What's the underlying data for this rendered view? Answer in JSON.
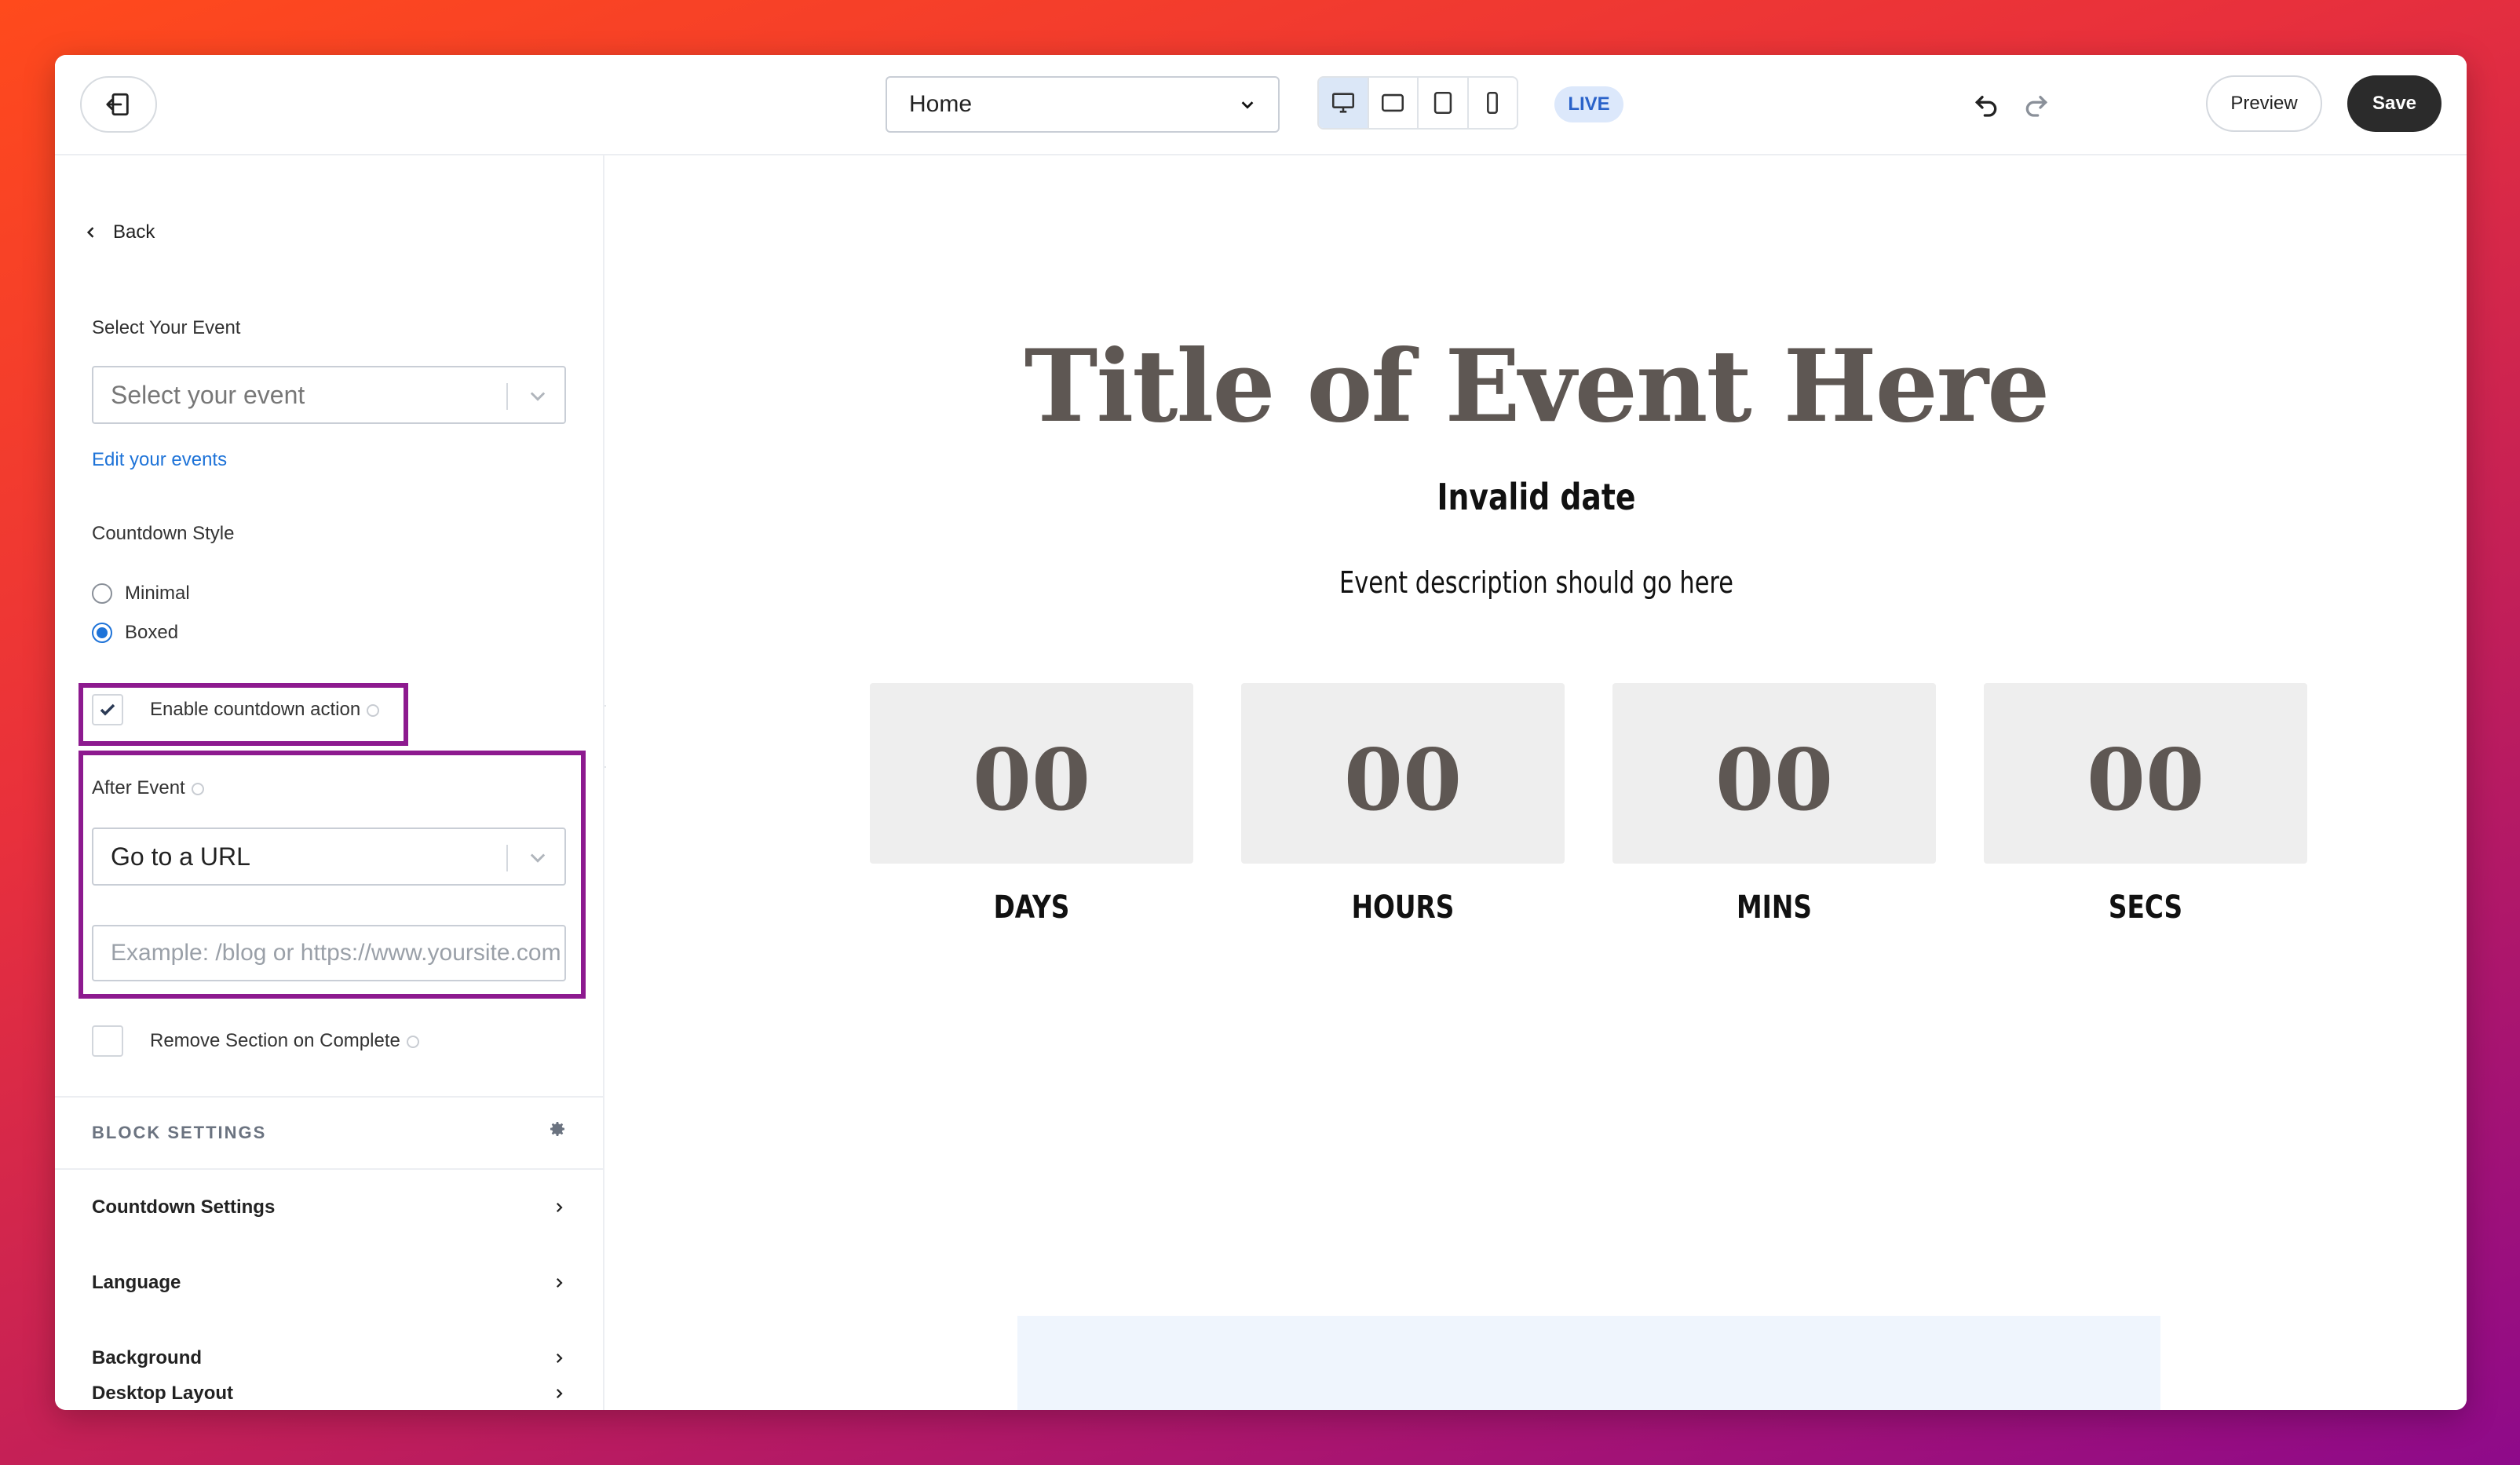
{
  "toolbar": {
    "page_select_value": "Home",
    "live_badge": "LIVE",
    "preview_label": "Preview",
    "save_label": "Save"
  },
  "sidebar": {
    "back_label": "Back",
    "select_event_label": "Select Your Event",
    "select_event_placeholder": "Select your event",
    "edit_events_link": "Edit your events",
    "countdown_style_label": "Countdown Style",
    "style_options": [
      "Minimal",
      "Boxed"
    ],
    "style_selected": "Boxed",
    "enable_action_label": "Enable countdown action",
    "enable_action_checked": true,
    "after_event_label": "After Event",
    "after_event_value": "Go to a URL",
    "url_placeholder": "Example: /blog or https://www.yoursite.com",
    "remove_section_label": "Remove Section on Complete",
    "remove_section_checked": false,
    "block_settings_label": "BLOCK SETTINGS",
    "accordion": [
      "Countdown Settings",
      "Language",
      "Background",
      "Desktop Layout"
    ]
  },
  "canvas": {
    "title": "Title of Event Here",
    "date": "Invalid date",
    "description": "Event description should go here",
    "countdown": [
      {
        "value": "00",
        "label": "DAYS"
      },
      {
        "value": "00",
        "label": "HOURS"
      },
      {
        "value": "00",
        "label": "MINS"
      },
      {
        "value": "00",
        "label": "SECS"
      }
    ]
  },
  "colors": {
    "highlight": "#8d1a8f",
    "link": "#1e73d8",
    "title": "#5e5753",
    "save_bg": "#2b2b2b"
  }
}
